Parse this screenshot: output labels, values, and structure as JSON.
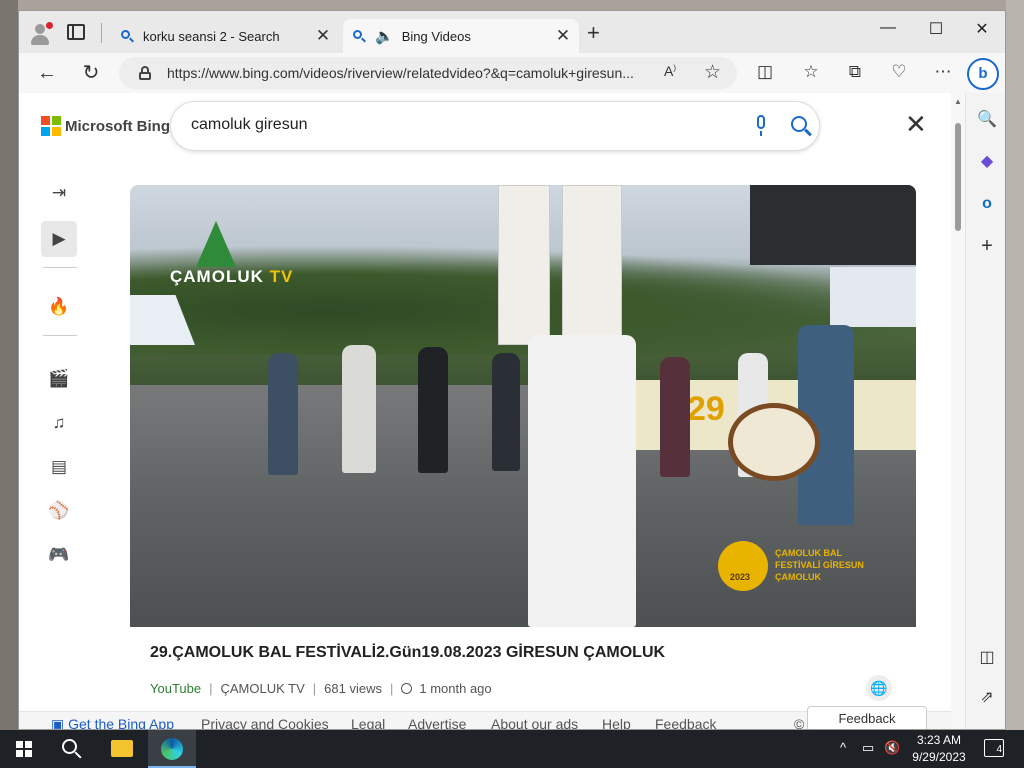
{
  "browser": {
    "tabs": [
      {
        "label": "korku seansi 2 - Search",
        "close": "✕"
      },
      {
        "label": "Bing Videos",
        "close": "✕"
      }
    ],
    "new_tab": "+",
    "url": "https://www.bing.com/videos/riverview/relatedvideo?&q=camoluk+giresun...",
    "window": {
      "minimize": "—",
      "maximize": "☐",
      "close": "✕"
    },
    "nav": {
      "back": "←",
      "refresh": "↻"
    }
  },
  "bing": {
    "logo_text": "Microsoft Bing",
    "search_value": "camoluk giresun"
  },
  "video": {
    "title": "29.ÇAMOLUK BAL FESTİVALİ2.Gün19.08.2023 GİRESUN ÇAMOLUK",
    "source": "YouTube",
    "channel": "ÇAMOLUK TV",
    "views": "681 views",
    "age": "1 month ago",
    "overlay_brand": "ÇAMOLUK",
    "overlay_tv": "TV",
    "festival_year": "2023",
    "festival_badge": "29",
    "festival_lines": "ÇAMOLUK BAL FESTİVALİ GİRESUN ÇAMOLUK"
  },
  "footer": {
    "get_app": "Get the Bing App",
    "privacy": "Privacy and Cookies",
    "legal": "Legal",
    "advertise": "Advertise",
    "about_ads": "About our ads",
    "help": "Help",
    "feedback": "Feedback",
    "copyright": "©",
    "feedback_button": "Feedback"
  },
  "taskbar": {
    "time": "3:23 AM",
    "date": "9/29/2023",
    "notifications": "4"
  },
  "colors": {
    "accent": "#1b6ac9",
    "source_green": "#2e7d32",
    "taskbar": "#1e2126"
  }
}
